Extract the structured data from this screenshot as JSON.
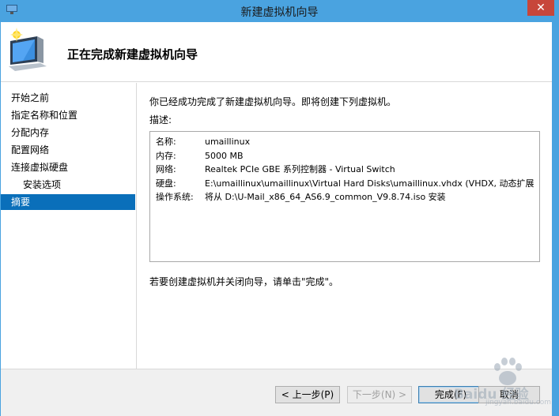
{
  "window": {
    "title": "新建虚拟机向导",
    "close_glyph": "✕"
  },
  "header": {
    "title": "正在完成新建虚拟机向导"
  },
  "nav": {
    "items": [
      {
        "label": "开始之前"
      },
      {
        "label": "指定名称和位置"
      },
      {
        "label": "分配内存"
      },
      {
        "label": "配置网络"
      },
      {
        "label": "连接虚拟硬盘"
      },
      {
        "label": "安装选项"
      },
      {
        "label": "摘要"
      }
    ],
    "active_index": 6
  },
  "main": {
    "intro": "你已经成功完成了新建虚拟机向导。即将创建下列虚拟机。",
    "desc_label": "描述:",
    "summary": [
      {
        "key": "名称:",
        "value": "umaillinux"
      },
      {
        "key": "内存:",
        "value": "5000 MB"
      },
      {
        "key": "网络:",
        "value": "Realtek PCIe GBE 系列控制器 - Virtual Switch"
      },
      {
        "key": "硬盘:",
        "value": "E:\\umaillinux\\umaillinux\\Virtual Hard Disks\\umaillinux.vhdx (VHDX, 动态扩展)"
      },
      {
        "key": "操作系统:",
        "value": "将从 D:\\U-Mail_x86_64_AS6.9_common_V9.8.74.iso 安装"
      }
    ],
    "finish_hint": "若要创建虚拟机并关闭向导，请单击\"完成\"。"
  },
  "buttons": {
    "prev": "< 上一步(P)",
    "next": "下一步(N) >",
    "finish": "完成(F)",
    "cancel": "取消"
  },
  "watermark": {
    "brand": "Baidu 经验",
    "url": "jingyan.baidu.com"
  },
  "colors": {
    "titlebar": "#4aa3e0",
    "close": "#c7463b",
    "nav_active": "#0a6fba"
  }
}
